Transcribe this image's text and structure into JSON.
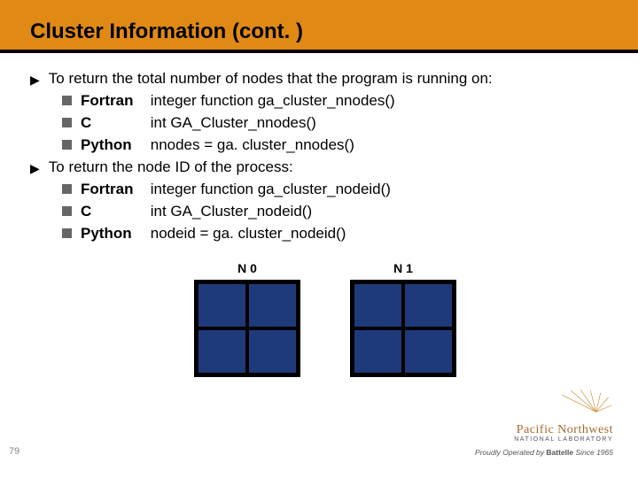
{
  "title": "Cluster Information (cont. )",
  "bullets": [
    {
      "text": "To return the total number of nodes that the program is running on:",
      "subs": [
        {
          "lang": "Fortran",
          "code": "integer function ga_cluster_nnodes()"
        },
        {
          "lang": "C",
          "code": "int GA_Cluster_nnodes()"
        },
        {
          "lang": "Python",
          "code": "nnodes = ga. cluster_nnodes()"
        }
      ]
    },
    {
      "text": "To return the node ID of the process:",
      "subs": [
        {
          "lang": "Fortran",
          "code": "integer function ga_cluster_nodeid()"
        },
        {
          "lang": "C",
          "code": "int GA_Cluster_nodeid()"
        },
        {
          "lang": "Python",
          "code": "nodeid = ga. cluster_nodeid()"
        }
      ]
    }
  ],
  "nodes": [
    "N 0",
    "N 1"
  ],
  "logo": {
    "lab": "Pacific Northwest",
    "natlab": "NATIONAL LABORATORY",
    "tagline_prefix": "Proudly Operated by ",
    "tagline_bold": "Battelle",
    "tagline_suffix": " Since 1965"
  },
  "page": "79"
}
